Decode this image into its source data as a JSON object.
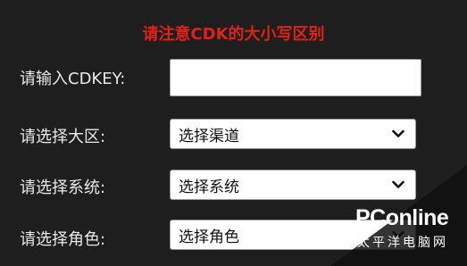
{
  "notice": "请注意CDK的大小写区别",
  "cdkey": {
    "label": "请输入CDKEY:",
    "value": ""
  },
  "region": {
    "label": "请选择大区:",
    "selected": "选择渠道"
  },
  "system": {
    "label": "请选择系统:",
    "selected": "选择系统"
  },
  "role": {
    "label": "请选择角色:",
    "selected": "选择角色"
  },
  "watermark": {
    "logo": "PConline",
    "subtitle": "太平洋电脑网"
  },
  "colors": {
    "background": "#1e1e1e",
    "notice": "#e0201a",
    "label": "#e8e8e8"
  }
}
